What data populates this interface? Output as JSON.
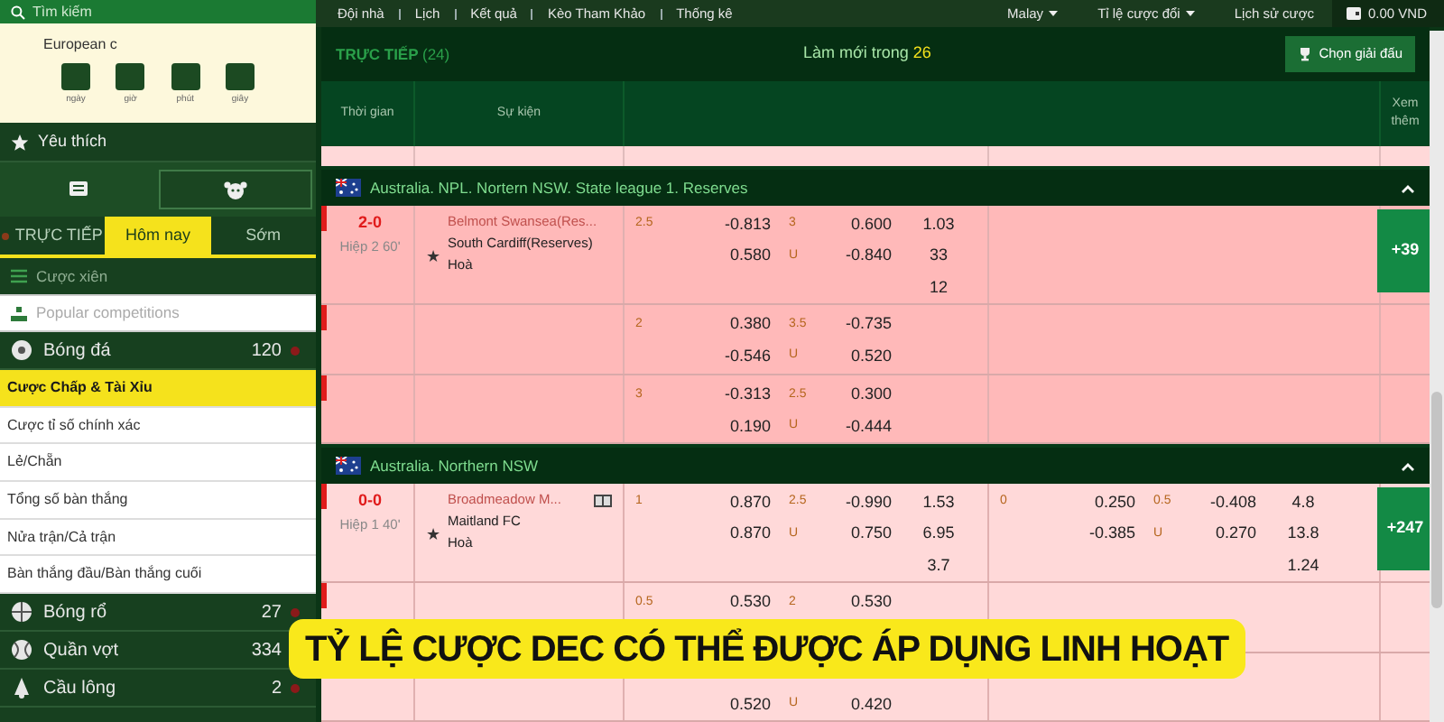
{
  "sidebar": {
    "search": {
      "placeholder": "Tìm kiếm"
    },
    "clock": {
      "title": "European c",
      "units": [
        "ngày",
        "giờ",
        "phút",
        "giây"
      ]
    },
    "favorites": "Yêu thích",
    "view_buttons": [
      {
        "kind": "list",
        "selected": false
      },
      {
        "kind": "ball",
        "selected": true
      }
    ],
    "tabs": [
      {
        "label": "TRỰC TIẾP",
        "selected": false,
        "live": true
      },
      {
        "label": "Hôm nay",
        "selected": true,
        "live": false
      },
      {
        "label": "Sớm",
        "selected": false,
        "live": false
      }
    ],
    "parlay": "Cược xiên",
    "popular": {
      "placeholder": "Popular competitions"
    },
    "sports_top": [
      {
        "kind": "soccer",
        "name": "Bóng đá",
        "count": "120"
      }
    ],
    "bet_types": [
      {
        "label": "Cược Chấp & Tài Xỉu",
        "selected": true
      },
      {
        "label": "Cược tỉ số chính xác",
        "selected": false
      },
      {
        "label": "Lẻ/Chẵn",
        "selected": false
      },
      {
        "label": "Tổng số bàn thắng",
        "selected": false
      },
      {
        "label": "Nửa trận/Cả trận",
        "selected": false
      },
      {
        "label": "Bàn thắng đầu/Bàn thắng cuối",
        "selected": false
      }
    ],
    "sports": [
      {
        "kind": "basketball",
        "name": "Bóng rổ",
        "count": "27"
      },
      {
        "kind": "tennis",
        "name": "Quần vợt",
        "count": "334"
      },
      {
        "kind": "badminton",
        "name": "Cầu lông",
        "count": "2"
      }
    ]
  },
  "top_nav": {
    "links": [
      "Đội nhà",
      "Lịch",
      "Kết quả",
      "Kèo Tham Khảo",
      "Thống kê"
    ],
    "dropdowns": [
      "Malay",
      "Tỉ lệ cược đổi"
    ],
    "history": "Lịch sử cược",
    "balance": "0.00 VND"
  },
  "header": {
    "live_label": "TRỰC TIẾP",
    "live_count": "(24)",
    "refresh_label": "Làm mới trong",
    "refresh_seconds": "26",
    "select_button": "Chọn giải đấu"
  },
  "columns": {
    "time": "Thời gian",
    "event": "Sự kiện",
    "more": "Xem thêm"
  },
  "leagues": [
    {
      "name": "Australia. NPL. Nortern NSW. State league 1. Reserves",
      "expanded": true,
      "color": "#ffb9b9",
      "matches": [
        {
          "score": "2-0",
          "period": "Hiệp 2 60'",
          "star": "★",
          "home": "Belmont Swansea(Res...",
          "away": "South Cardiff(Reserves)",
          "draw": "Hoà",
          "tv": false,
          "more": "+39",
          "rows": [
            {
              "full": [
                {
                  "hdp_line": "2.5",
                  "hdp": "-0.813",
                  "ou_line": "3",
                  "ou": "0.600",
                  "x12": "1.03"
                },
                {
                  "hdp": "0.580",
                  "ou_line": "U",
                  "ou": "-0.840",
                  "x12": "33"
                },
                {
                  "x12": "12"
                }
              ]
            },
            {
              "full": [
                {
                  "hdp_line": "2",
                  "hdp": "0.380",
                  "ou_line": "3.5",
                  "ou": "-0.735"
                },
                {
                  "hdp": "-0.546",
                  "ou_line": "U",
                  "ou": "0.520"
                }
              ]
            },
            {
              "full": [
                {
                  "hdp_line": "3",
                  "hdp": "-0.313",
                  "ou_line": "2.5",
                  "ou": "0.300"
                },
                {
                  "hdp": "0.190",
                  "ou_line": "U",
                  "ou": "-0.444"
                }
              ]
            }
          ]
        }
      ]
    },
    {
      "name": "Australia. Northern NSW",
      "expanded": true,
      "color": "#ffd9d9",
      "matches": [
        {
          "score": "0-0",
          "period": "Hiệp 1 40'",
          "star": "★",
          "home": "Broadmeadow M...",
          "away": "Maitland FC",
          "draw": "Hoà",
          "tv": true,
          "more": "+247",
          "rows": [
            {
              "full": [
                {
                  "hdp_line": "1",
                  "hdp": "0.870",
                  "ou_line": "2.5",
                  "ou": "-0.990",
                  "x12": "1.53"
                },
                {
                  "hdp": "0.870",
                  "ou_line": "U",
                  "ou": "0.750",
                  "x12": "6.95"
                },
                {
                  "x12": "3.7"
                }
              ],
              "half": [
                {
                  "hdp_line": "0",
                  "hdp": "0.250",
                  "ou_line": "0.5",
                  "ou": "-0.408",
                  "x12": "4.8"
                },
                {
                  "hdp": "-0.385",
                  "ou_line": "U",
                  "ou": "0.270",
                  "x12": "13.8"
                },
                {
                  "x12": "1.24"
                }
              ]
            },
            {
              "full": [
                {
                  "hdp_line": "0.5",
                  "hdp": "0.530",
                  "ou_line": "2",
                  "ou": "0.530"
                }
              ]
            },
            {
              "full": [
                {
                  "hdp": "0.520",
                  "ou_line": "U",
                  "ou": "0.420"
                }
              ]
            }
          ]
        }
      ]
    }
  ],
  "caption": "TỶ LỆ CƯỢC DEC CÓ THỂ ĐƯỢC ÁP DỤNG LINH HOẠT"
}
